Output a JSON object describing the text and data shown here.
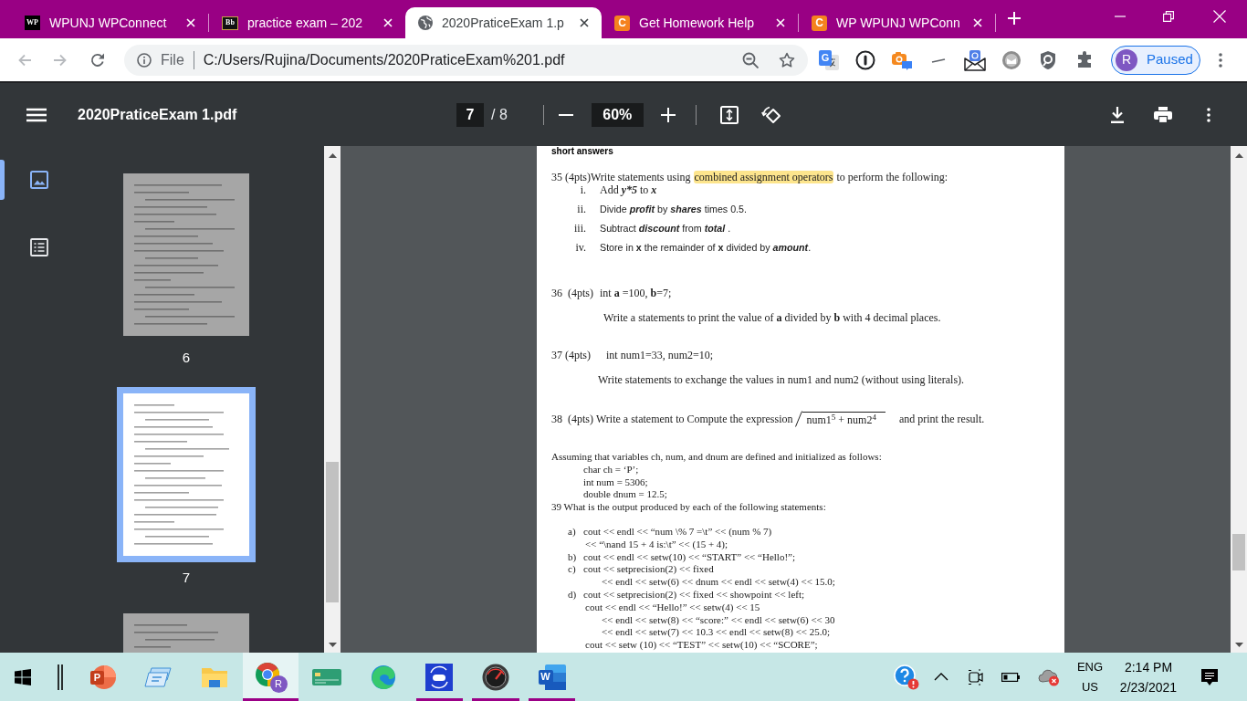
{
  "browser": {
    "tabs": [
      {
        "title": "WPUNJ WPConnect",
        "kind": "square",
        "icon_text": "WP",
        "selected": false
      },
      {
        "title": "practice exam – 202",
        "kind": "framed",
        "icon_text": "Bb",
        "selected": false
      },
      {
        "title": "2020PraticeExam 1.p",
        "kind": "globe",
        "selected": true
      },
      {
        "title": "Get Homework Help",
        "kind": "rounded",
        "icon_text": "C",
        "selected": false
      },
      {
        "title": "WP WPUNJ WPConn",
        "kind": "rounded",
        "icon_text": "C",
        "selected": false
      }
    ],
    "address": {
      "scheme": "File",
      "url": "C:/Users/Rujina/Documents/2020PraticeExam%201.pdf"
    },
    "extensions": [
      {
        "kind": "translate",
        "icon_text": "G"
      },
      {
        "kind": "keyhole"
      },
      {
        "kind": "camera"
      },
      {
        "kind": "dash"
      },
      {
        "kind": "envelope"
      },
      {
        "kind": "sphere"
      },
      {
        "kind": "shield"
      },
      {
        "kind": "puzzle"
      }
    ],
    "profile": {
      "initial": "R",
      "status": "Paused"
    }
  },
  "pdf_viewer": {
    "title": "2020PraticeExam 1.pdf",
    "page": "7",
    "page_count": "/ 8",
    "zoom": "60%",
    "rail": [
      {
        "kind": "thumbnails",
        "selected": true
      },
      {
        "kind": "outline",
        "selected": false
      }
    ],
    "thumbnails": [
      {
        "label": "6",
        "selected": false
      },
      {
        "label": "7",
        "selected": true
      },
      {
        "selected": false
      }
    ],
    "document": {
      "heading": "short answers",
      "q35": {
        "lead": "35 (4pts)Write statements using",
        "highlight": "combined assignment operators",
        "tail": "to perform the following:",
        "items": [
          {
            "marker": "i.",
            "kind": "expression",
            "parts": [
              {
                "text": "Add ",
                "kind": "plain"
              },
              {
                "text": "y*5",
                "kind": "term"
              },
              {
                "text": " to ",
                "kind": "plain"
              },
              {
                "text": "x",
                "kind": "term"
              }
            ]
          },
          {
            "marker": "ii.",
            "kind": "instruction",
            "parts": [
              {
                "text": "Divide ",
                "kind": "plain"
              },
              {
                "text": "profit",
                "kind": "term"
              },
              {
                "text": " by ",
                "kind": "plain"
              },
              {
                "text": "shares",
                "kind": "term"
              },
              {
                "text": " times 0.5.",
                "kind": "plain"
              }
            ]
          },
          {
            "marker": "iii.",
            "kind": "instruction",
            "parts": [
              {
                "text": "Subtract ",
                "kind": "plain"
              },
              {
                "text": "discount",
                "kind": "term"
              },
              {
                "text": "  from ",
                "kind": "plain"
              },
              {
                "text": "total",
                "kind": "term"
              },
              {
                "text": " .",
                "kind": "plain"
              }
            ]
          },
          {
            "marker": "iv.",
            "kind": "instruction",
            "parts": [
              {
                "text": "Store in ",
                "kind": "plain"
              },
              {
                "text": "x",
                "kind": "symbol"
              },
              {
                "text": " the remainder of ",
                "kind": "plain"
              },
              {
                "text": "x",
                "kind": "symbol"
              },
              {
                "text": " divided by ",
                "kind": "plain"
              },
              {
                "text": "amount",
                "kind": "term"
              },
              {
                "text": ".",
                "kind": "plain"
              }
            ]
          }
        ]
      },
      "q36": {
        "number": "36  (4pts)",
        "code": "int **a** =100, **b**=7;",
        "task": "Write a statements to print the value of **a** divided by **b** with 4 decimal places."
      },
      "q37": {
        "number": "37 (4pts)",
        "code": "int num1=33, num2=10;",
        "task": "Write statements to exchange the values in num1 and num2 (without using literals)."
      },
      "q38": {
        "number": "38  (4pts)",
        "lead": "Write a statement to Compute the expression",
        "formula": "num1$^{5}$ + num2$^{4}$",
        "tail": "and print the result."
      },
      "q39": {
        "intro": "Assuming that variables ch, num, and dnum are defined and initialized as follows:",
        "declarations": [
          "char ch = ‘P’;",
          "int num = 5306;",
          "double dnum = 12.5;"
        ],
        "question": "39 What is the output produced by each of the following statements:",
        "statements": [
          {
            "label": "a)",
            "text": "cout << endl << “num \\% 7 =\\t” << (num % 7)",
            "more": [
              {
                "text": "<< “\\nand 15 + 4 is:\\t” << (15 + 4);",
                "kind": "line"
              }
            ]
          },
          {
            "label": "b)",
            "text": "cout << endl << setw(10) << “START” << “Hello!”;"
          },
          {
            "label": "c)",
            "text": "cout << setprecision(2) << fixed",
            "more": [
              {
                "text": "<< endl << setw(6) << dnum << endl << setw(4) << 15.0;",
                "kind": "deep"
              }
            ]
          },
          {
            "label": "d)",
            "text": "cout << setprecision(2) << fixed << showpoint << left;",
            "more": [
              {
                "text": "cout << endl << “Hello!” << setw(4) << 15",
                "kind": "line"
              },
              {
                "text": "<< endl << setw(8) << “score:” << endl << setw(6) << 30",
                "kind": "deep"
              },
              {
                "text": "<< endl << setw(7) << 10.3 << endl << setw(8) << 25.0;",
                "kind": "deep"
              },
              {
                "text": "cout << setw (10) << “TEST” << setw(10) << “SCORE”;",
                "kind": "line"
              }
            ]
          }
        ]
      }
    }
  },
  "taskbar": {
    "apps": [
      {
        "kind": "start",
        "open": false,
        "selected": false
      },
      {
        "kind": "bars",
        "open": false,
        "selected": false
      },
      {
        "kind": "slides",
        "letter": "P",
        "open": false,
        "selected": false
      },
      {
        "kind": "cards",
        "open": false,
        "selected": false
      },
      {
        "kind": "folder",
        "open": false,
        "selected": false
      },
      {
        "kind": "browser",
        "badge": "R",
        "open": true,
        "selected": true
      },
      {
        "kind": "money",
        "open": false,
        "selected": false
      },
      {
        "kind": "edge",
        "open": false,
        "selected": false
      },
      {
        "kind": "sync",
        "open": true,
        "selected": false
      },
      {
        "kind": "meter",
        "open": true,
        "selected": false
      },
      {
        "kind": "word",
        "letter": "W",
        "open": true,
        "selected": false
      }
    ],
    "tray": [
      {
        "kind": "help"
      },
      {
        "kind": "chevron"
      },
      {
        "kind": "camera"
      },
      {
        "kind": "battery"
      },
      {
        "kind": "cloud"
      }
    ],
    "language": "ENG",
    "region": "US",
    "time": "2:14 PM",
    "date": "2/23/2021"
  }
}
